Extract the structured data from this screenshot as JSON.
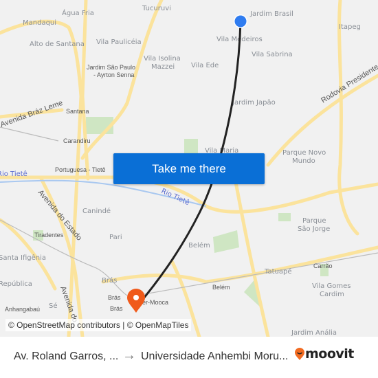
{
  "map": {
    "labels": [
      "Água Fria",
      "Tucuruvi",
      "Jardim Brasil",
      "Mandaqui",
      "Itapeg",
      "Alto de Santana",
      "Vila Paulicéia",
      "Vila Medeiros",
      "Vila Sabrina",
      "Vila Isolina",
      "Mazzei",
      "Vila Ede",
      "Jardim Japão",
      "Vila Maria",
      "Parque Novo",
      "Mundo",
      "Canindé",
      "Pari",
      "Belém",
      "Parque",
      "São Jorge",
      "Santa Ifigênia",
      "República",
      "Tatuapé",
      "Vila Gomes",
      "Cardim",
      "Jardim Anália",
      "Brás",
      "Sé",
      "Carrão",
      "Jardim São Paulo",
      "- Ayrton Senna",
      "Santana",
      "Carandiru",
      "Portuguesa - Tietê",
      "Tiradentes",
      "Anhangabaú",
      "Brás",
      "Brás",
      "Belém",
      "er-Mooca"
    ],
    "roads": [
      "Avenida Bráz Leme",
      "Rodovia Presidente",
      "Avenida do Estado",
      "Avenida do"
    ],
    "rivers": [
      "Rio Tietê",
      "Rio Tietê"
    ],
    "origin_color": "#2f7cf0",
    "destination_color": "#f05a1a",
    "route_color": "#222222"
  },
  "cta": {
    "label": "Take me there",
    "color": "#0a6fd6"
  },
  "attribution": "© OpenStreetMap contributors | © OpenMapTiles",
  "footer": {
    "from": "Av. Roland Garros, ...",
    "arrow_icon": "arrow-right-icon",
    "to": "Universidade Anhembi Moru...",
    "brand": "moovit",
    "brand_color": "#f26b21"
  }
}
